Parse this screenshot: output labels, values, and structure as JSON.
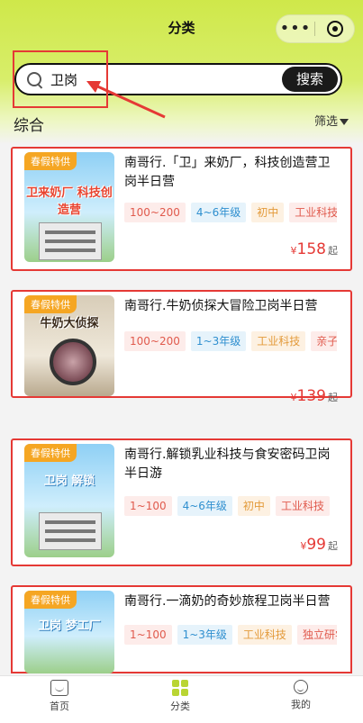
{
  "header": {
    "title": "分类"
  },
  "search": {
    "value": "卫岗",
    "button_label": "搜索"
  },
  "section": {
    "title": "综合",
    "filter_label": "筛选"
  },
  "products": [
    {
      "badge": "春假特供",
      "poster_text": "卫来奶厂 科技创造营",
      "title": "南哥行.「卫」来奶厂，科技创造营卫岗半日营",
      "tags": [
        "100~200",
        "4~6年级",
        "初中",
        "工业科技"
      ],
      "price_currency": "¥",
      "price": "158",
      "price_unit": "起"
    },
    {
      "badge": "春假特供",
      "poster_text": "牛奶大侦探",
      "title": "南哥行.牛奶侦探大冒险卫岗半日营",
      "tags": [
        "100~200",
        "1~3年级",
        "工业科技",
        "亲子研"
      ],
      "price_currency": "¥",
      "price": "139",
      "price_unit": "起"
    },
    {
      "badge": "春假特供",
      "poster_text": "卫岗 解锁",
      "title": "南哥行.解锁乳业科技与食安密码卫岗半日游",
      "tags": [
        "1~100",
        "4~6年级",
        "初中",
        "工业科技"
      ],
      "price_currency": "¥",
      "price": "99",
      "price_unit": "起"
    },
    {
      "badge": "春假特供",
      "poster_text": "卫岗 梦工厂",
      "title": "南哥行.一滴奶的奇妙旅程卫岗半日营",
      "tags": [
        "1~100",
        "1~3年级",
        "工业科技",
        "独立研学"
      ]
    }
  ],
  "tabbar": {
    "items": [
      {
        "label": "首页"
      },
      {
        "label": "分类"
      },
      {
        "label": "我的"
      }
    ]
  },
  "colors": {
    "accent": "#cfe84a",
    "price": "#e53935",
    "annotation": "#e53935"
  }
}
